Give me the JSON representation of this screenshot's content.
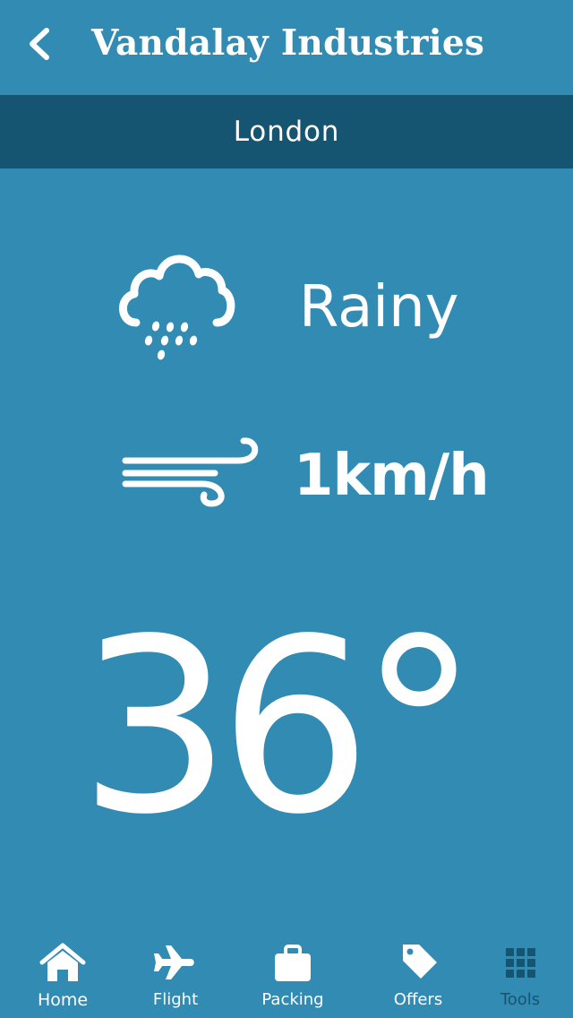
{
  "header": {
    "title": "Vandalay Industries",
    "back_icon": "chevron-left-icon"
  },
  "location": {
    "city": "London"
  },
  "weather": {
    "condition": "Rainy",
    "condition_icon": "rain-cloud-icon",
    "wind_speed": "1km/h",
    "wind_icon": "wind-icon",
    "temperature": "36°"
  },
  "tabbar": {
    "items": [
      {
        "label": "Home",
        "icon": "home-icon",
        "active": true
      },
      {
        "label": "Flight",
        "icon": "airplane-icon"
      },
      {
        "label": "Packing",
        "icon": "suitcase-icon"
      },
      {
        "label": "Offers",
        "icon": "tag-icon"
      },
      {
        "label": "Tools",
        "icon": "grid-icon"
      }
    ]
  },
  "colors": {
    "background": "#318bb2",
    "city_bar": "#165571",
    "text": "#ffffff",
    "tools_tab": "#165571"
  }
}
